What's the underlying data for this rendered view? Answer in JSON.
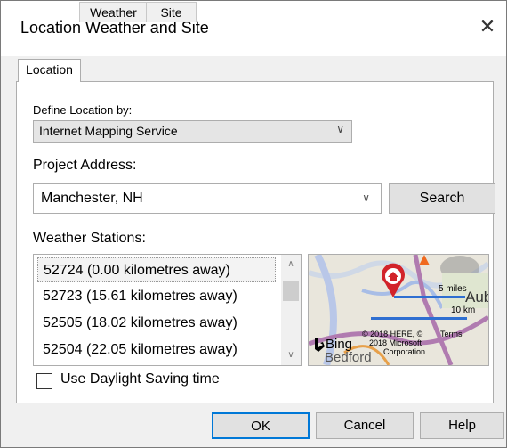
{
  "window": {
    "title": "Location Weather and Site",
    "close_glyph": "✕"
  },
  "tabs": [
    {
      "label": "Location",
      "active": true
    },
    {
      "label": "Weather",
      "active": false
    },
    {
      "label": "Site",
      "active": false
    }
  ],
  "location": {
    "define_label": "Define Location by:",
    "define_value": "Internet Mapping Service",
    "project_address_label": "Project Address:",
    "project_address_value": "Manchester, NH",
    "search_label": "Search",
    "weather_stations_label": "Weather Stations:",
    "stations": [
      "52724 (0.00 kilometres away)",
      "52723 (15.61 kilometres away)",
      "52505 (18.02 kilometres away)",
      "52504 (22.05 kilometres away)"
    ],
    "selected_station_index": 0,
    "daylight_saving_label": "Use Daylight Saving time",
    "daylight_saving_checked": false
  },
  "map": {
    "scale_miles": "5 miles",
    "scale_km": "10 km",
    "place_partial_1": "Aub",
    "place_partial_2": "Bedford",
    "brand": "Bing",
    "copyright_line1": "© 2018 HERE, ©",
    "copyright_line2": "2018 Microsoft",
    "copyright_line3": "Corporation",
    "terms": "Terms"
  },
  "footer": {
    "ok_label": "OK",
    "cancel_label": "Cancel",
    "help_label": "Help"
  }
}
